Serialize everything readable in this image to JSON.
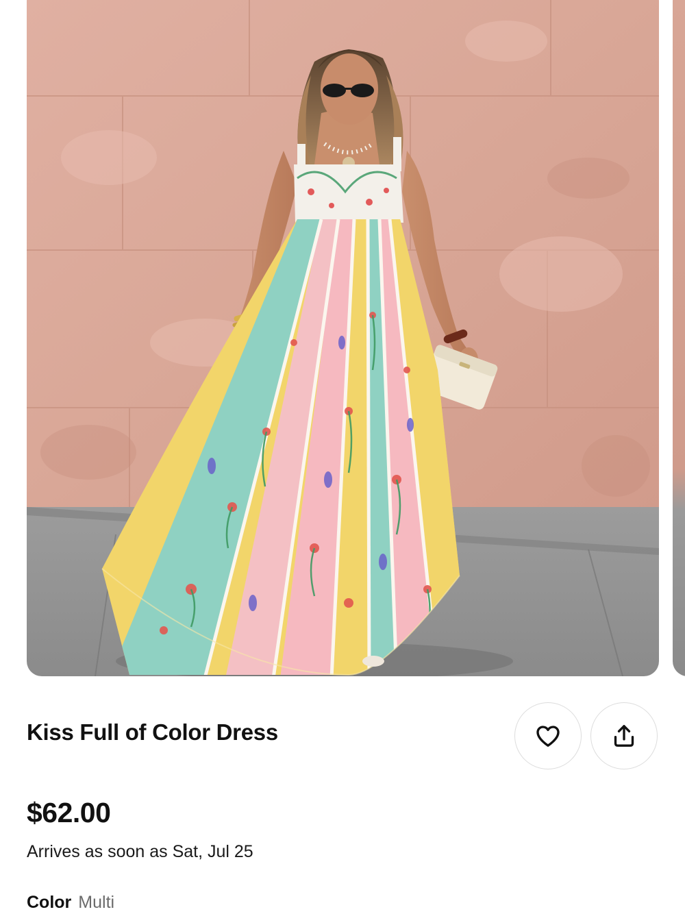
{
  "product": {
    "title": "Kiss Full of Color Dress",
    "price": "$62.00",
    "arrival": "Arrives as soon as Sat, Jul 25",
    "color_label": "Color",
    "color_value": "Multi"
  },
  "actions": {
    "favorite_icon": "heart-icon",
    "share_icon": "share-icon"
  },
  "gallery": {
    "visible_images": 1
  },
  "colors": {
    "text": "#111111",
    "muted": "#6b6b6b",
    "button_border": "#dcdcdc"
  }
}
